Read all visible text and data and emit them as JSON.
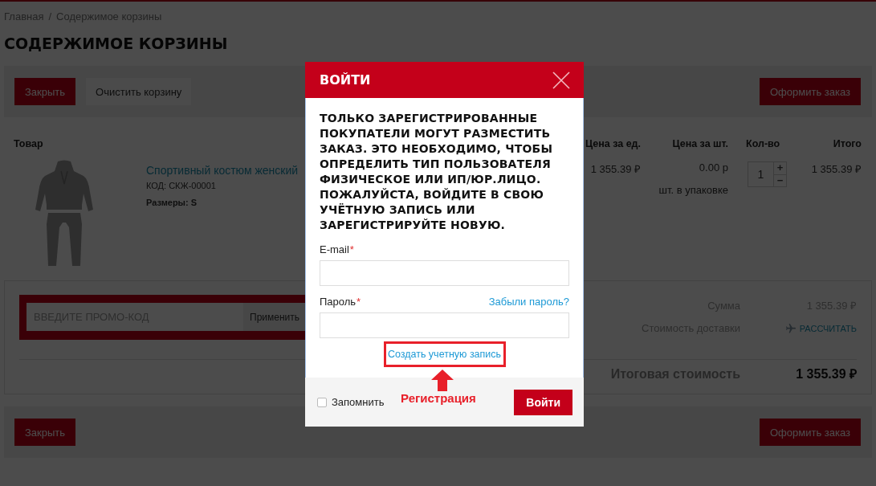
{
  "breadcrumbs": {
    "items": [
      "Главная",
      "Содержимое корзины"
    ],
    "separator": "/"
  },
  "page_title": "СОДЕРЖИМОЕ КОРЗИНЫ",
  "top_toolbar": {
    "left_buttons": [
      {
        "label": "Закрыть",
        "kind": "primary"
      },
      {
        "label": "Очистить корзину",
        "kind": "secondary"
      }
    ],
    "right_buttons": [
      {
        "label": "Оформить заказ",
        "kind": "primary"
      }
    ]
  },
  "cart_table": {
    "columns": [
      "Товар",
      "Цена за ед.",
      "Цена за шт.",
      "Кол-во",
      "Итого"
    ],
    "rows": [
      {
        "name": "Спортивный костюм женский",
        "code": "КОД: СКЖ-00001",
        "sizes": "Размеры: S",
        "unit_price": "1 355.39 ₽",
        "piece_price": "0.00 р",
        "pack_note": "шт. в упаковке",
        "quantity": "1",
        "increment": "+",
        "decrement": "−",
        "total": "1 355.39 ₽"
      }
    ]
  },
  "summary": {
    "promo": {
      "placeholder": "ВВЕДИТЕ ПРОМО-КОД",
      "button": "Применить"
    },
    "lines": [
      {
        "label": "Сумма",
        "value": "1 355.39 ₽",
        "kind": "amount"
      },
      {
        "label": "Стоимость доставки",
        "value": "РАССЧИТАТЬ",
        "kind": "action"
      }
    ],
    "total": {
      "label": "Итоговая стоимость",
      "value": "1 355.39 ₽"
    }
  },
  "bottom_toolbar": {
    "left_buttons": [
      {
        "label": "Закрыть",
        "kind": "primary"
      }
    ],
    "right_buttons": [
      {
        "label": "Оформить заказ",
        "kind": "primary"
      }
    ]
  },
  "login_dialog": {
    "title": "ВОЙТИ",
    "message": "ТОЛЬКО ЗАРЕГИСТРИРОВАННЫЕ ПОКУПАТЕЛИ МОГУТ РАЗМЕСТИТЬ ЗАКАЗ. ЭТО НЕОБХОДИМО, ЧТОБЫ ОПРЕДЕЛИТЬ ТИП ПОЛЬЗОВАТЕЛЯ ФИЗИЧЕСКОЕ ИЛИ ИП/ЮР.ЛИЦО. ПОЖАЛУЙСТА, ВОЙДИТЕ В СВОЮ УЧЁТНУЮ ЗАПИСЬ ИЛИ ЗАРЕГИСТРИРУЙТЕ НОВУЮ.",
    "fields": [
      {
        "label": "E-mail",
        "required_mark": "*"
      },
      {
        "label": "Пароль",
        "required_mark": "*",
        "link": "Забыли пароль?"
      }
    ],
    "register_link": "Создать учетную запись",
    "remember": {
      "label": "Запомнить",
      "checked": false
    },
    "submit": "Войти"
  },
  "annotation": {
    "label": "Регистрация"
  }
}
